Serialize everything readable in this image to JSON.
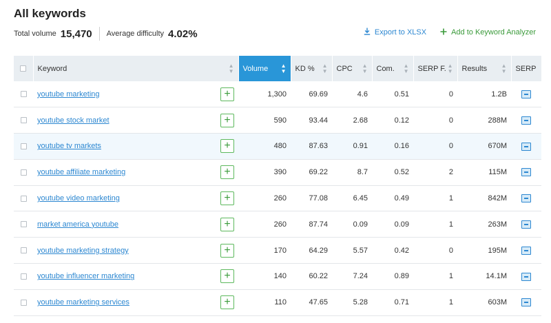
{
  "header": {
    "title": "All keywords",
    "total_volume_label": "Total volume",
    "total_volume_value": "15,470",
    "avg_difficulty_label": "Average difficulty",
    "avg_difficulty_value": "4.02%"
  },
  "actions": {
    "export_label": "Export to XLSX",
    "add_label": "Add to Keyword Analyzer"
  },
  "columns": {
    "keyword": "Keyword",
    "volume": "Volume",
    "kd": "KD %",
    "cpc": "CPC",
    "com": "Com.",
    "serp_f": "SERP F.",
    "results": "Results",
    "serp": "SERP"
  },
  "sorted_column": "volume",
  "colors": {
    "accent": "#2996d8",
    "link": "#2c87d1",
    "add_green": "#3a9a3a",
    "header_bg": "#e9eef2",
    "row_highlight": "#f1f8fd"
  },
  "rows": [
    {
      "keyword": "youtube marketing",
      "volume": "1,300",
      "kd": "69.69",
      "cpc": "4.6",
      "com": "0.51",
      "serp_f": "0",
      "results": "1.2B"
    },
    {
      "keyword": "youtube stock market",
      "volume": "590",
      "kd": "93.44",
      "cpc": "2.68",
      "com": "0.12",
      "serp_f": "0",
      "results": "288M"
    },
    {
      "keyword": "youtube tv markets",
      "volume": "480",
      "kd": "87.63",
      "cpc": "0.91",
      "com": "0.16",
      "serp_f": "0",
      "results": "670M"
    },
    {
      "keyword": "youtube affiliate marketing",
      "volume": "390",
      "kd": "69.22",
      "cpc": "8.7",
      "com": "0.52",
      "serp_f": "2",
      "results": "115M"
    },
    {
      "keyword": "youtube video marketing",
      "volume": "260",
      "kd": "77.08",
      "cpc": "6.45",
      "com": "0.49",
      "serp_f": "1",
      "results": "842M"
    },
    {
      "keyword": "market america youtube",
      "volume": "260",
      "kd": "87.74",
      "cpc": "0.09",
      "com": "0.09",
      "serp_f": "1",
      "results": "263M"
    },
    {
      "keyword": "youtube marketing strategy",
      "volume": "170",
      "kd": "64.29",
      "cpc": "5.57",
      "com": "0.42",
      "serp_f": "0",
      "results": "195M"
    },
    {
      "keyword": "youtube influencer marketing",
      "volume": "140",
      "kd": "60.22",
      "cpc": "7.24",
      "com": "0.89",
      "serp_f": "1",
      "results": "14.1M"
    },
    {
      "keyword": "youtube marketing services",
      "volume": "110",
      "kd": "47.65",
      "cpc": "5.28",
      "com": "0.71",
      "serp_f": "1",
      "results": "603M"
    }
  ]
}
